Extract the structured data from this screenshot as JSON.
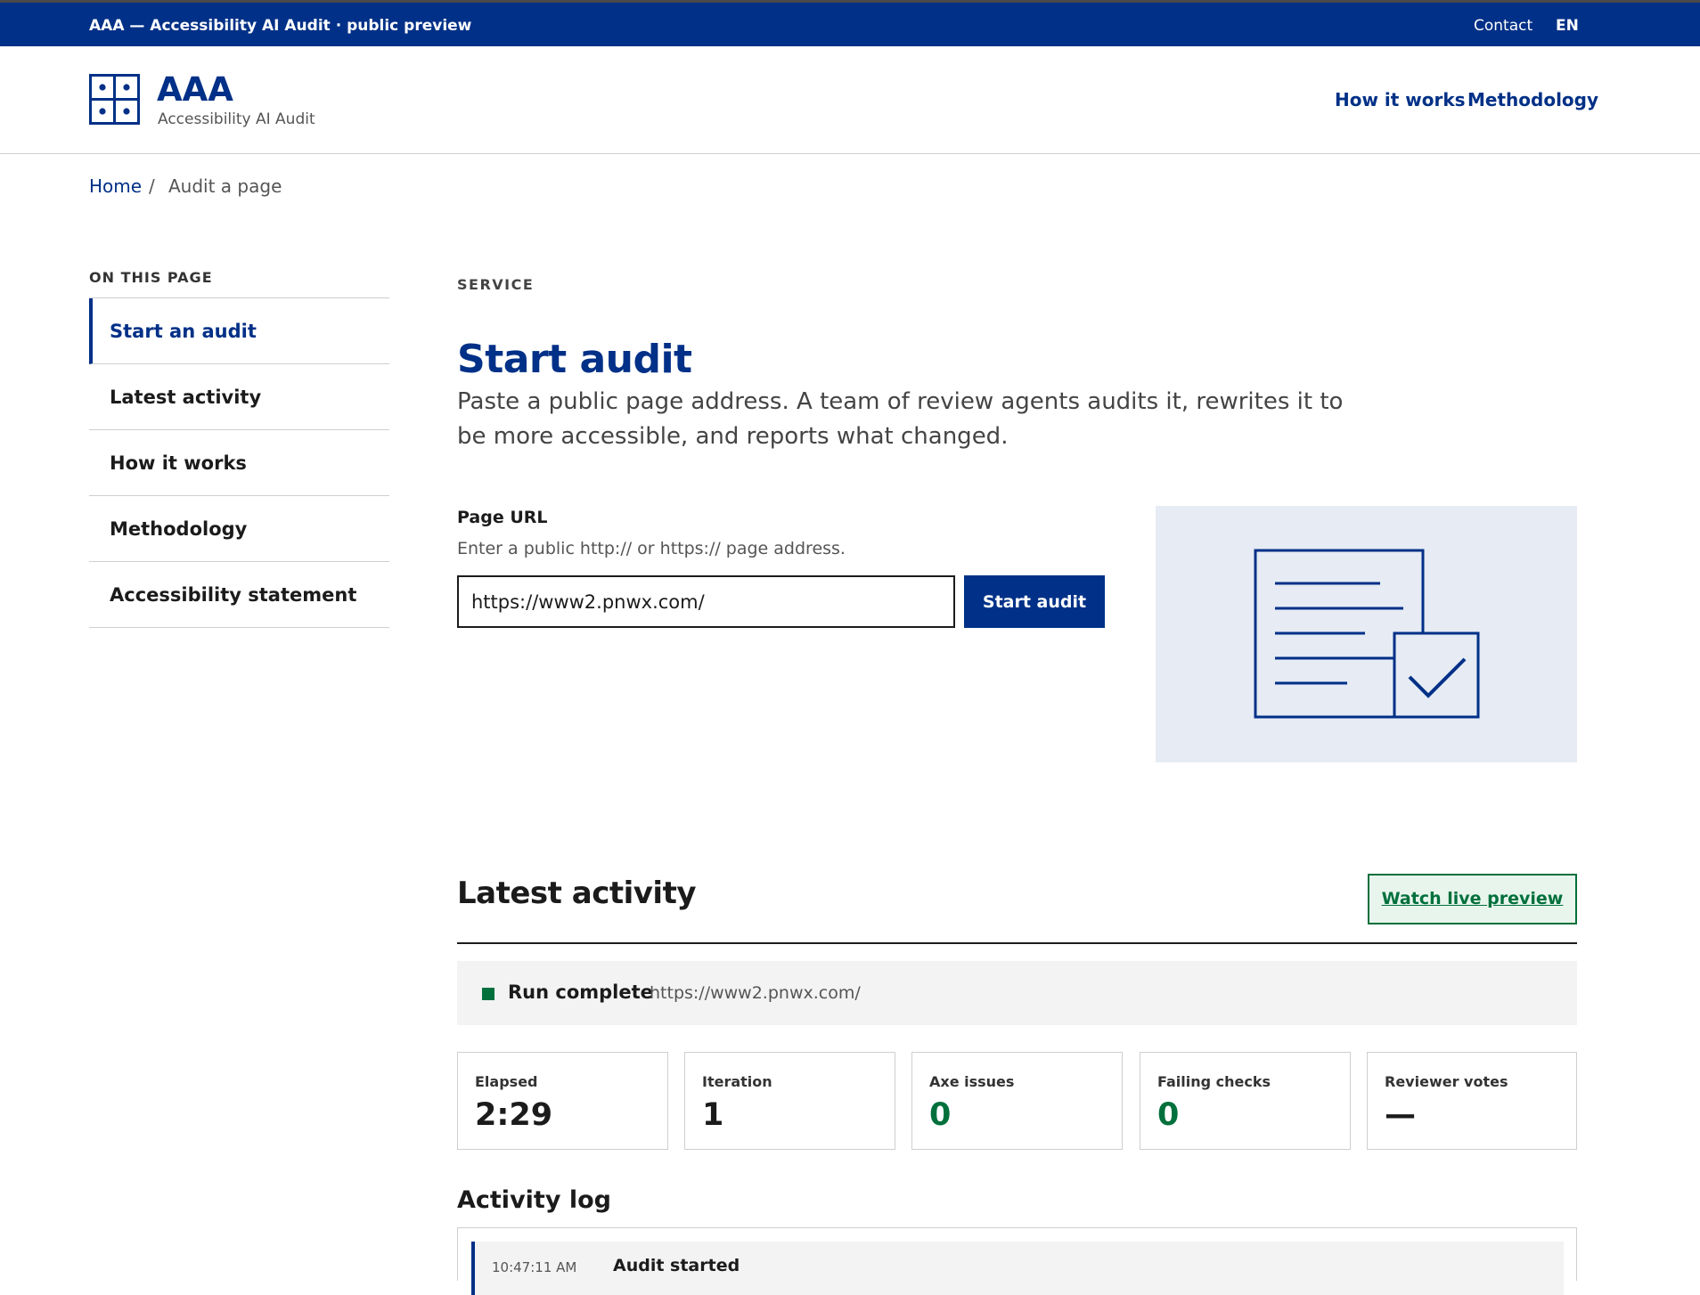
{
  "utility": {
    "brand": "AAA — Accessibility AI Audit · public preview",
    "contact": "Contact",
    "lang": "EN"
  },
  "header": {
    "title": "AAA",
    "subtitle": "Accessibility AI Audit",
    "nav": [
      "How it works",
      "Methodology"
    ]
  },
  "breadcrumb": {
    "home": "Home",
    "separator": "/",
    "current": "Audit a page"
  },
  "sidebar": {
    "heading": "ON THIS PAGE",
    "items": [
      {
        "label": "Start an audit"
      },
      {
        "label": "Latest activity"
      },
      {
        "label": "How it works"
      },
      {
        "label": "Methodology"
      },
      {
        "label": "Accessibility statement"
      }
    ]
  },
  "main": {
    "eyebrow": "SERVICE",
    "title": "Start audit",
    "lead": "Paste a public page address. A team of review agents audits it, rewrites it to be more accessible, and reports what changed.",
    "field_label": "Page URL",
    "field_hint": "Enter a public http:// or https:// page address.",
    "url_value": "https://www2.pnwx.com/",
    "start_button": "Start audit"
  },
  "activity": {
    "title": "Latest activity",
    "watch_button": "Watch live preview",
    "status_label": "Run complete",
    "status_url": "https://www2.pnwx.com/",
    "status_color": "#00703c",
    "stats": [
      {
        "label": "Elapsed",
        "value": "2:29"
      },
      {
        "label": "Iteration",
        "value": "1"
      },
      {
        "label": "Axe issues",
        "value": "0"
      },
      {
        "label": "Failing checks",
        "value": "0"
      },
      {
        "label": "Reviewer votes",
        "value": "—"
      }
    ],
    "log_title": "Activity log",
    "log": [
      {
        "time": "10:47:11 AM",
        "title": "Audit started"
      }
    ]
  },
  "icons": {
    "logo": "grid-dots-icon",
    "illustration": "document-check-icon"
  },
  "colors": {
    "brand": "#003087",
    "success": "#00703c"
  }
}
